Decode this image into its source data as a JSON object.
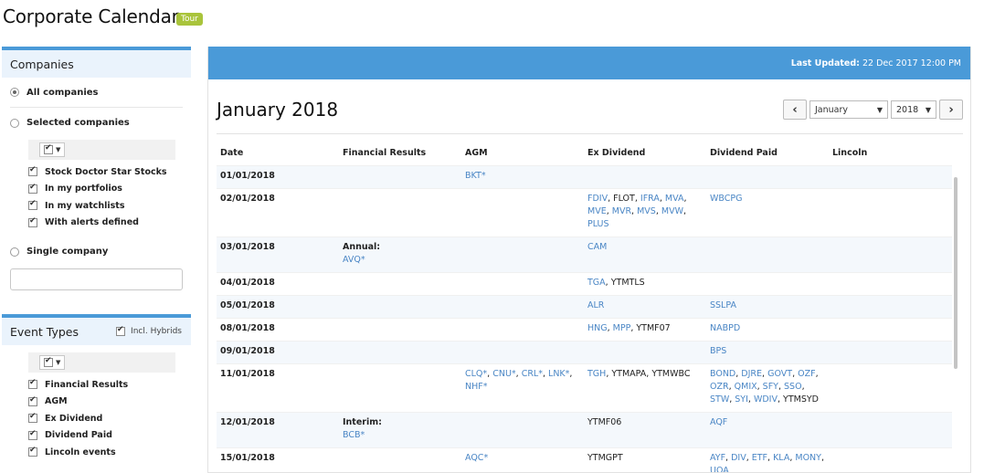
{
  "page": {
    "title": "Corporate Calendar",
    "tour_label": "Tour"
  },
  "companies": {
    "header": "Companies",
    "all_label": "All companies",
    "selected_label": "Selected companies",
    "options": [
      "Stock Doctor Star Stocks",
      "In my portfolios",
      "In my watchlists",
      "With alerts defined"
    ],
    "single_label": "Single company",
    "single_value": ""
  },
  "event_types": {
    "header": "Event Types",
    "hybrids_label": "Incl. Hybrids",
    "options": [
      "Financial Results",
      "AGM",
      "Ex Dividend",
      "Dividend Paid",
      "Lincoln events"
    ]
  },
  "main": {
    "last_updated_label": "Last Updated:",
    "last_updated_value": "22 Dec 2017 12:00 PM",
    "month_title": "January 2018",
    "month_select": "January",
    "year_select": "2018",
    "prev_glyph": "‹",
    "next_glyph": "›"
  },
  "table": {
    "columns": [
      "Date",
      "Financial Results",
      "AGM",
      "Ex Dividend",
      "Dividend Paid",
      "Lincoln"
    ],
    "rows": [
      {
        "date": "01/01/2018",
        "fin_label": "",
        "fin": [],
        "agm": [
          {
            "t": "BKT*",
            "link": true
          }
        ],
        "exdiv": [],
        "paid": []
      },
      {
        "date": "02/01/2018",
        "fin_label": "",
        "fin": [],
        "agm": [],
        "exdiv": [
          {
            "t": "FDIV",
            "link": true
          },
          {
            "t": "FLOT",
            "link": false
          },
          {
            "t": "IFRA",
            "link": true
          },
          {
            "t": "MVA",
            "link": true
          },
          {
            "t": "MVE",
            "link": true
          },
          {
            "t": "MVR",
            "link": true
          },
          {
            "t": "MVS",
            "link": true
          },
          {
            "t": "MVW",
            "link": true
          },
          {
            "t": "PLUS",
            "link": true
          }
        ],
        "paid": [
          {
            "t": "WBCPG",
            "link": true
          }
        ]
      },
      {
        "date": "03/01/2018",
        "fin_label": "Annual:",
        "fin": [
          {
            "t": "AVQ*",
            "link": true
          }
        ],
        "agm": [],
        "exdiv": [
          {
            "t": "CAM",
            "link": true
          }
        ],
        "paid": []
      },
      {
        "date": "04/01/2018",
        "fin_label": "",
        "fin": [],
        "agm": [],
        "exdiv": [
          {
            "t": "TGA",
            "link": true
          },
          {
            "t": "YTMTLS",
            "link": false
          }
        ],
        "paid": []
      },
      {
        "date": "05/01/2018",
        "fin_label": "",
        "fin": [],
        "agm": [],
        "exdiv": [
          {
            "t": "ALR",
            "link": true
          }
        ],
        "paid": [
          {
            "t": "SSLPA",
            "link": true
          }
        ]
      },
      {
        "date": "08/01/2018",
        "fin_label": "",
        "fin": [],
        "agm": [],
        "exdiv": [
          {
            "t": "HNG",
            "link": true
          },
          {
            "t": "MPP",
            "link": true
          },
          {
            "t": "YTMF07",
            "link": false
          }
        ],
        "paid": [
          {
            "t": "NABPD",
            "link": true
          }
        ]
      },
      {
        "date": "09/01/2018",
        "fin_label": "",
        "fin": [],
        "agm": [],
        "exdiv": [],
        "paid": [
          {
            "t": "BPS",
            "link": true
          }
        ]
      },
      {
        "date": "11/01/2018",
        "fin_label": "",
        "fin": [],
        "agm": [
          {
            "t": "CLQ*",
            "link": true
          },
          {
            "t": "CNU*",
            "link": true
          },
          {
            "t": "CRL*",
            "link": true
          },
          {
            "t": "LNK*",
            "link": true
          },
          {
            "t": "NHF*",
            "link": true
          }
        ],
        "exdiv": [
          {
            "t": "TGH",
            "link": true
          },
          {
            "t": "YTMAPA",
            "link": false
          },
          {
            "t": "YTMWBC",
            "link": false
          }
        ],
        "paid": [
          {
            "t": "BOND",
            "link": true
          },
          {
            "t": "DJRE",
            "link": true
          },
          {
            "t": "GOVT",
            "link": true
          },
          {
            "t": "OZF",
            "link": true
          },
          {
            "t": "OZR",
            "link": true
          },
          {
            "t": "QMIX",
            "link": true
          },
          {
            "t": "SFY",
            "link": true
          },
          {
            "t": "SSO",
            "link": true
          },
          {
            "t": "STW",
            "link": true
          },
          {
            "t": "SYI",
            "link": true
          },
          {
            "t": "WDIV",
            "link": true
          },
          {
            "t": "YTMSYD",
            "link": false
          }
        ]
      },
      {
        "date": "12/01/2018",
        "fin_label": "Interim:",
        "fin": [
          {
            "t": "BCB*",
            "link": true
          }
        ],
        "agm": [],
        "exdiv": [
          {
            "t": "YTMF06",
            "link": false
          }
        ],
        "paid": [
          {
            "t": "AQF",
            "link": true
          }
        ]
      },
      {
        "date": "15/01/2018",
        "fin_label": "",
        "fin": [],
        "agm": [
          {
            "t": "AQC*",
            "link": true
          }
        ],
        "exdiv": [
          {
            "t": "YTMGPT",
            "link": false
          }
        ],
        "paid": [
          {
            "t": "AYF",
            "link": true
          },
          {
            "t": "DIV",
            "link": true
          },
          {
            "t": "ETF",
            "link": true
          },
          {
            "t": "KLA",
            "link": true
          },
          {
            "t": "MONY",
            "link": true
          },
          {
            "t": "UOA",
            "link": true
          }
        ]
      }
    ]
  }
}
